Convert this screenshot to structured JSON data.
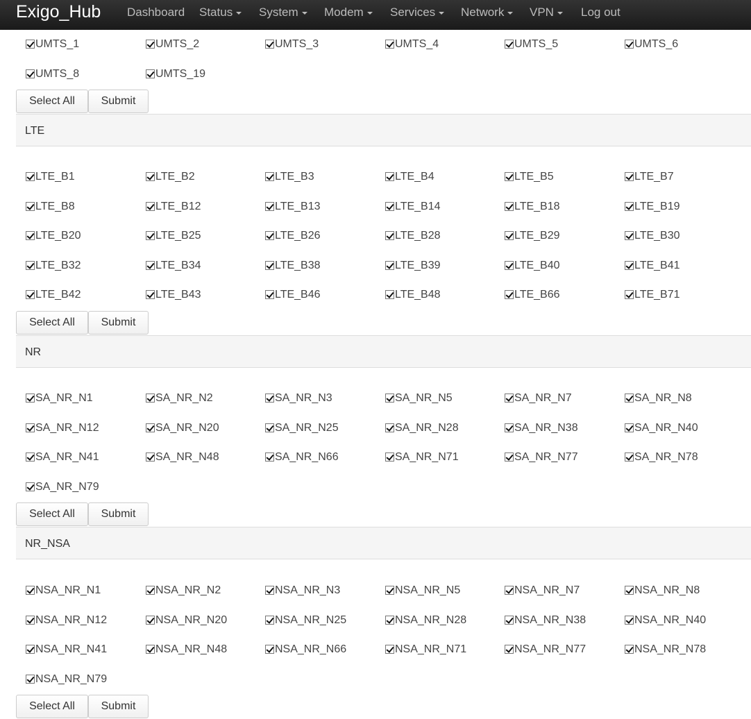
{
  "navbar": {
    "brand": "Exigo_Hub",
    "items": [
      {
        "label": "Dashboard",
        "dropdown": false
      },
      {
        "label": "Status",
        "dropdown": true
      },
      {
        "label": "System",
        "dropdown": true
      },
      {
        "label": "Modem",
        "dropdown": true
      },
      {
        "label": "Services",
        "dropdown": true
      },
      {
        "label": "Network",
        "dropdown": true
      },
      {
        "label": "VPN",
        "dropdown": true
      },
      {
        "label": "Log out",
        "dropdown": false
      }
    ]
  },
  "sections": [
    {
      "title": "",
      "bands": [
        "UMTS_1",
        "UMTS_2",
        "UMTS_3",
        "UMTS_4",
        "UMTS_5",
        "UMTS_6",
        "UMTS_8",
        "UMTS_19"
      ],
      "checked": true,
      "select_all_label": "Select All",
      "submit_label": "Submit"
    },
    {
      "title": "LTE",
      "bands": [
        "LTE_B1",
        "LTE_B2",
        "LTE_B3",
        "LTE_B4",
        "LTE_B5",
        "LTE_B7",
        "LTE_B8",
        "LTE_B12",
        "LTE_B13",
        "LTE_B14",
        "LTE_B18",
        "LTE_B19",
        "LTE_B20",
        "LTE_B25",
        "LTE_B26",
        "LTE_B28",
        "LTE_B29",
        "LTE_B30",
        "LTE_B32",
        "LTE_B34",
        "LTE_B38",
        "LTE_B39",
        "LTE_B40",
        "LTE_B41",
        "LTE_B42",
        "LTE_B43",
        "LTE_B46",
        "LTE_B48",
        "LTE_B66",
        "LTE_B71"
      ],
      "checked": true,
      "select_all_label": "Select All",
      "submit_label": "Submit"
    },
    {
      "title": "NR",
      "bands": [
        "SA_NR_N1",
        "SA_NR_N2",
        "SA_NR_N3",
        "SA_NR_N5",
        "SA_NR_N7",
        "SA_NR_N8",
        "SA_NR_N12",
        "SA_NR_N20",
        "SA_NR_N25",
        "SA_NR_N28",
        "SA_NR_N38",
        "SA_NR_N40",
        "SA_NR_N41",
        "SA_NR_N48",
        "SA_NR_N66",
        "SA_NR_N71",
        "SA_NR_N77",
        "SA_NR_N78",
        "SA_NR_N79"
      ],
      "checked": true,
      "select_all_label": "Select All",
      "submit_label": "Submit"
    },
    {
      "title": "NR_NSA",
      "bands": [
        "NSA_NR_N1",
        "NSA_NR_N2",
        "NSA_NR_N3",
        "NSA_NR_N5",
        "NSA_NR_N7",
        "NSA_NR_N8",
        "NSA_NR_N12",
        "NSA_NR_N20",
        "NSA_NR_N25",
        "NSA_NR_N28",
        "NSA_NR_N38",
        "NSA_NR_N40",
        "NSA_NR_N41",
        "NSA_NR_N48",
        "NSA_NR_N66",
        "NSA_NR_N71",
        "NSA_NR_N77",
        "NSA_NR_N78",
        "NSA_NR_N79"
      ],
      "checked": true,
      "select_all_label": "Select All",
      "submit_label": "Submit"
    }
  ]
}
